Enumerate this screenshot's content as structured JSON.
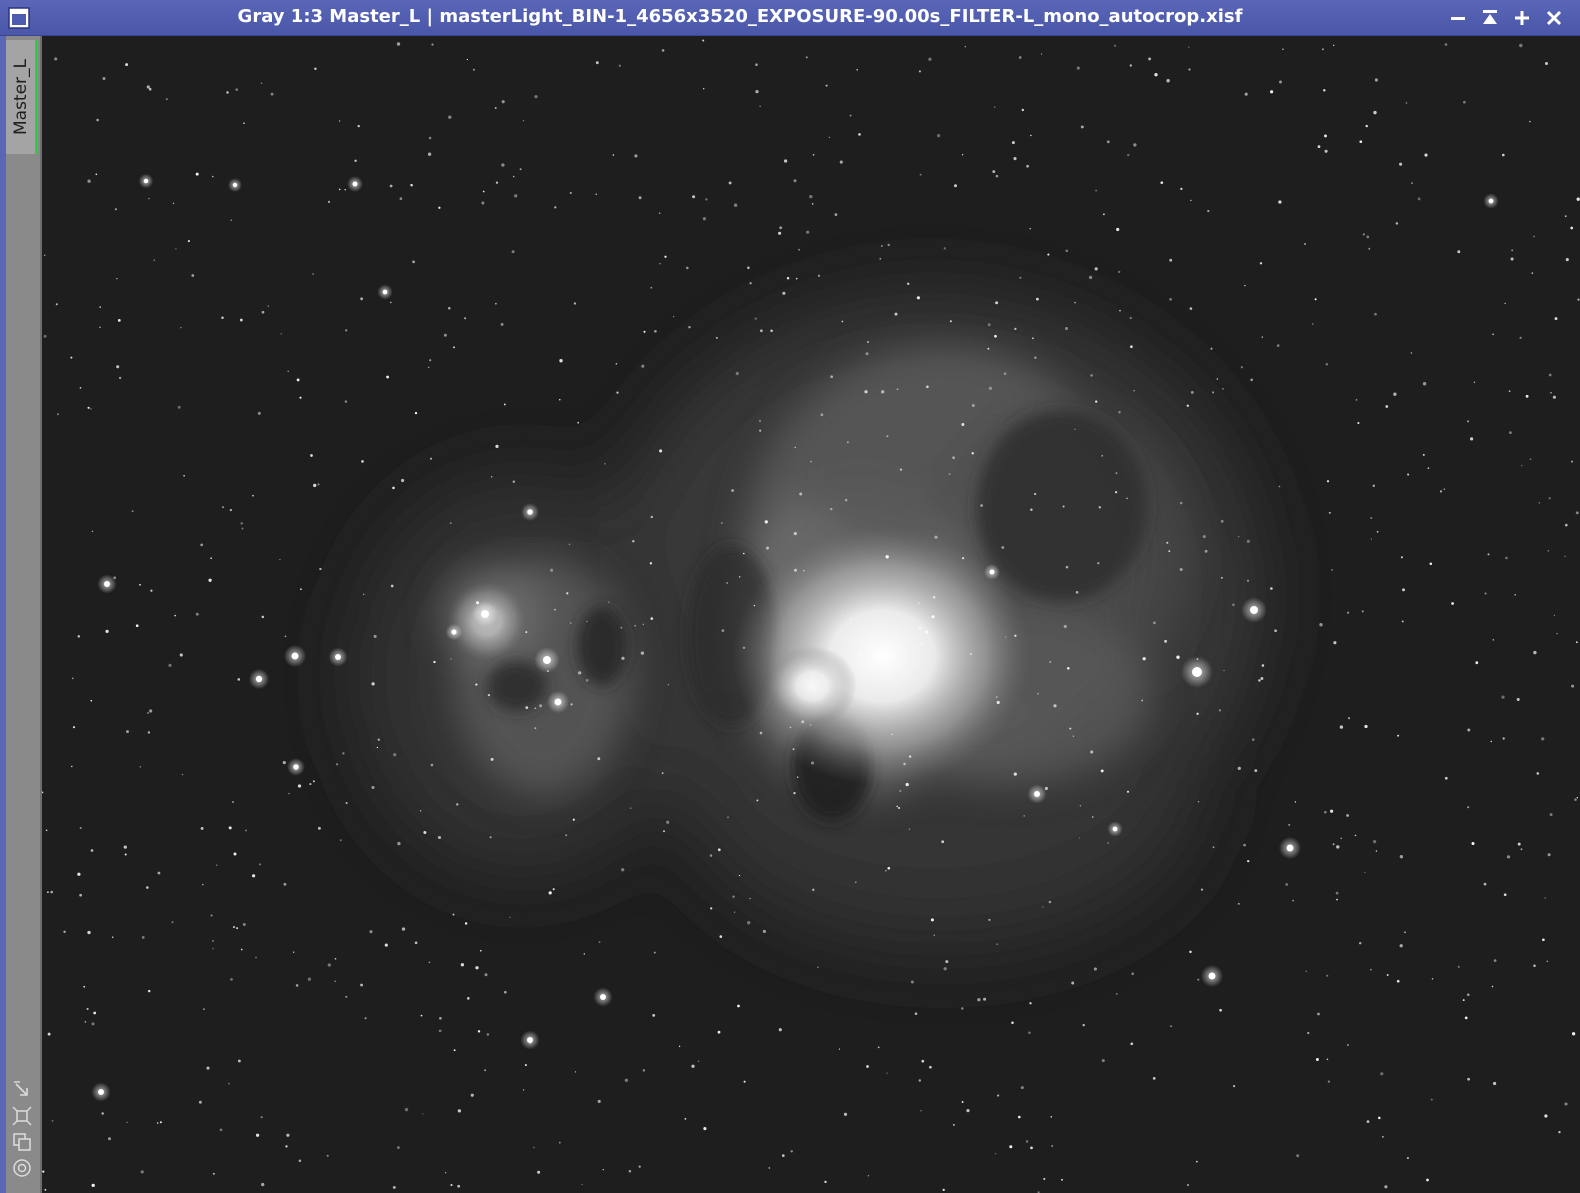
{
  "window": {
    "title": "Gray 1:3 Master_L | masterLight_BIN-1_4656x3520_EXPOSURE-90.00s_FILTER-L_mono_autocrop.xisf",
    "icon": "image-window-icon",
    "buttons": [
      "minimize-icon",
      "shade-icon",
      "maximize-icon",
      "close-icon"
    ],
    "titlebar_color": "#4f5bb0"
  },
  "sidebar": {
    "tab_label": "Master_L",
    "tab_active_color": "#2ecc40",
    "tools": [
      "fit-view-icon",
      "zoom-to-selection-icon",
      "clone-view-icon",
      "preview-target-icon"
    ]
  },
  "image": {
    "subject": "Orion Nebula (M42) and Running Man Nebula",
    "mode": "Gray",
    "zoom": "1:3",
    "identifier": "Master_L"
  }
}
